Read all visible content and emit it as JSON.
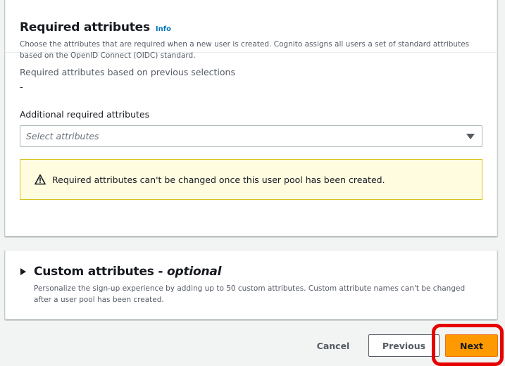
{
  "required_section": {
    "title": "Required attributes",
    "info_link": "Info",
    "description": "Choose the attributes that are required when a new user is created. Cognito assigns all users a set of standard attributes based on the OpenID Connect (OIDC) standard.",
    "previous_label": "Required attributes based on previous selections",
    "previous_value": "-",
    "additional_label": "Additional required attributes",
    "select_placeholder": "Select attributes",
    "alert_text": "Required attributes can't be changed once this user pool has been created."
  },
  "custom_section": {
    "title": "Custom attributes - ",
    "title_optional": "optional",
    "description": "Personalize the sign-up experience by adding up to 50 custom attributes. Custom attribute names can't be changed after a user pool has been created."
  },
  "footer": {
    "cancel_label": "Cancel",
    "previous_label": "Previous",
    "next_label": "Next"
  },
  "colors": {
    "primary_button": "#ff9900",
    "link": "#0073bb",
    "warning_bg": "#fffce0",
    "highlight": "#e60000"
  },
  "icons": [
    "warning-icon",
    "caret-down-icon",
    "expand-caret-icon"
  ]
}
